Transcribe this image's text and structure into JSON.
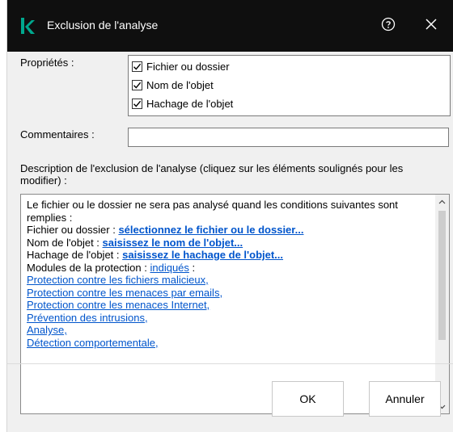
{
  "window": {
    "title": "Exclusion de l'analyse"
  },
  "form": {
    "properties_label": "Propriétés :",
    "properties": [
      {
        "label": "Fichier ou dossier",
        "checked": true
      },
      {
        "label": "Nom de l'objet",
        "checked": true
      },
      {
        "label": "Hachage de l'objet",
        "checked": true
      }
    ],
    "comments_label": "Commentaires :",
    "comments_value": "",
    "description_label": "Description de l'exclusion de l'analyse (cliquez sur les éléments soulignés pour les modifier) :"
  },
  "description": {
    "intro": "Le fichier ou le dossier ne sera pas analysé quand les conditions suivantes sont remplies :",
    "file_label": "Fichier ou dossier : ",
    "file_link": "sélectionnez le fichier ou le dossier...",
    "name_label": "Nom de l'objet : ",
    "name_link": "saisissez le nom de l'objet...",
    "hash_label": "Hachage de l'objet : ",
    "hash_link": "saisissez le hachage de l'objet...",
    "modules_label": "Modules de la protection : ",
    "modules_link": "indiqués",
    "modules_suffix": " :",
    "modules": [
      "Protection contre les fichiers malicieux,",
      "Protection contre les menaces par emails,",
      "Protection contre les menaces Internet,",
      "Prévention des intrusions,",
      "Analyse,",
      "Détection comportementale,"
    ]
  },
  "buttons": {
    "ok": "OK",
    "cancel": "Annuler"
  },
  "colors": {
    "titlebar": "#0f0f0f",
    "brand": "#00a88e",
    "link": "#0055cc"
  }
}
